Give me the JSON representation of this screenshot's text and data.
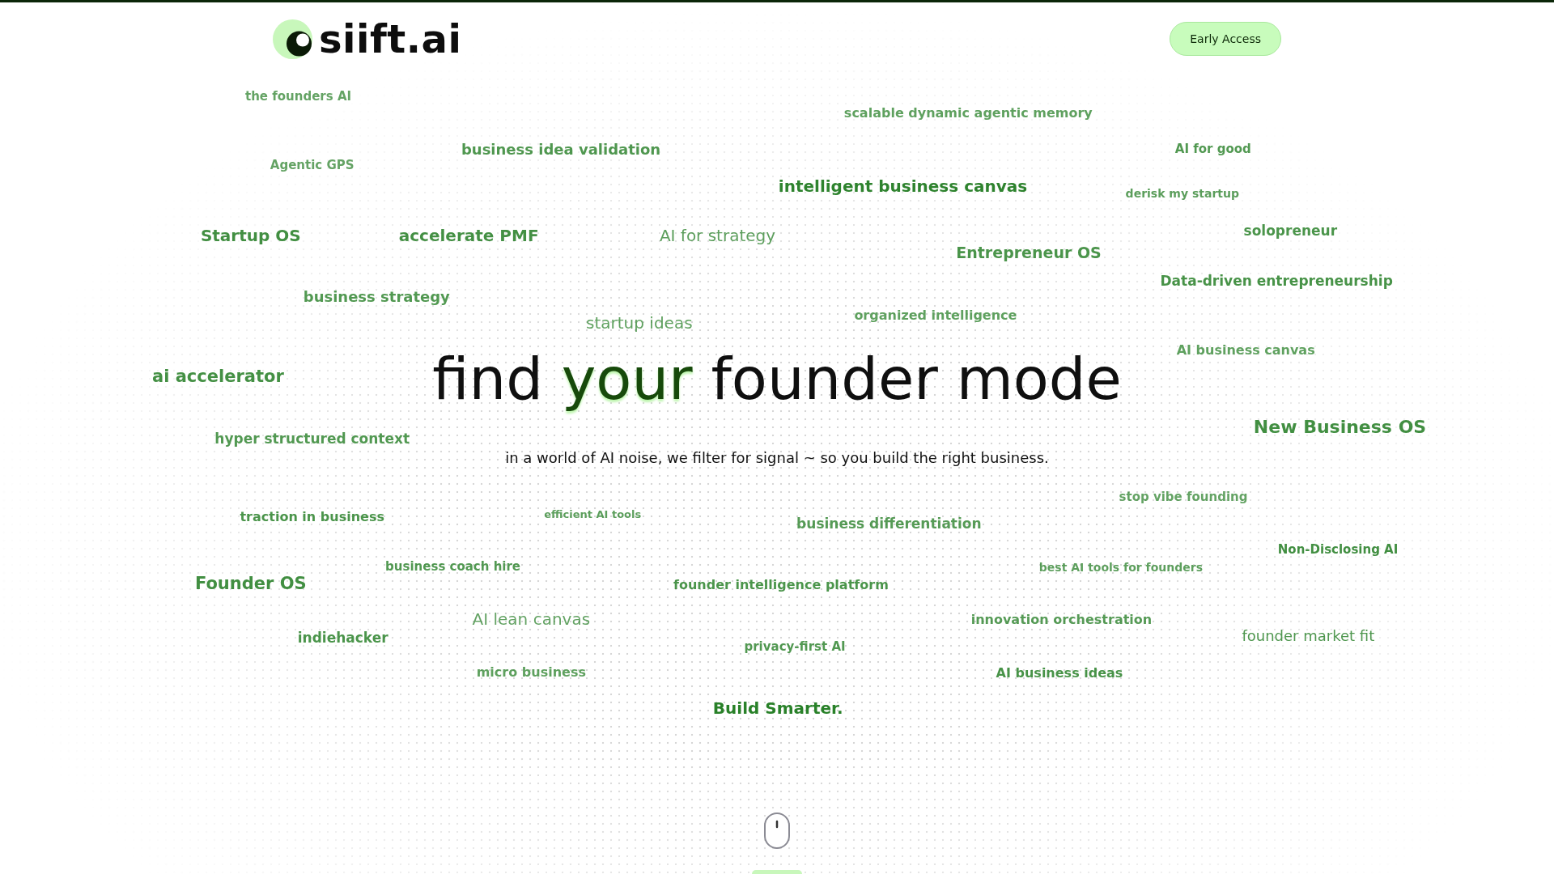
{
  "header": {
    "logo_text": "siift.ai",
    "button": "Early Access"
  },
  "hero": {
    "headline": [
      {
        "text": "find ",
        "highlight": false
      },
      {
        "text": "your",
        "highlight": true
      },
      {
        "text": " founder mode",
        "highlight": false
      }
    ],
    "subtitle": "in a world of AI noise, we filter for signal ~ so you build the right business."
  },
  "word_cloud": [
    "the founders AI",
    "scalable dynamic agentic memory",
    "business idea validation",
    "AI for good",
    "Agentic GPS",
    "intelligent business canvas",
    "derisk my startup",
    "Startup OS",
    "accelerate PMF",
    "AI for strategy",
    "solopreneur",
    "Entrepreneur OS",
    "Data-driven entrepreneurship",
    "business strategy",
    "startup ideas",
    "organized intelligence",
    "AI business canvas",
    "ai accelerator",
    "hyper structured context",
    "New Business OS",
    "stop vibe founding",
    "traction in business",
    "efficient AI tools",
    "business differentiation",
    "Non-Disclosing AI",
    "business coach hire",
    "best AI tools for founders",
    "Founder OS",
    "founder intelligence platform",
    "AI lean canvas",
    "innovation orchestration",
    "indiehacker",
    "privacy-first AI",
    "founder market fit",
    "micro business",
    "AI business ideas",
    "Build Smarter."
  ]
}
